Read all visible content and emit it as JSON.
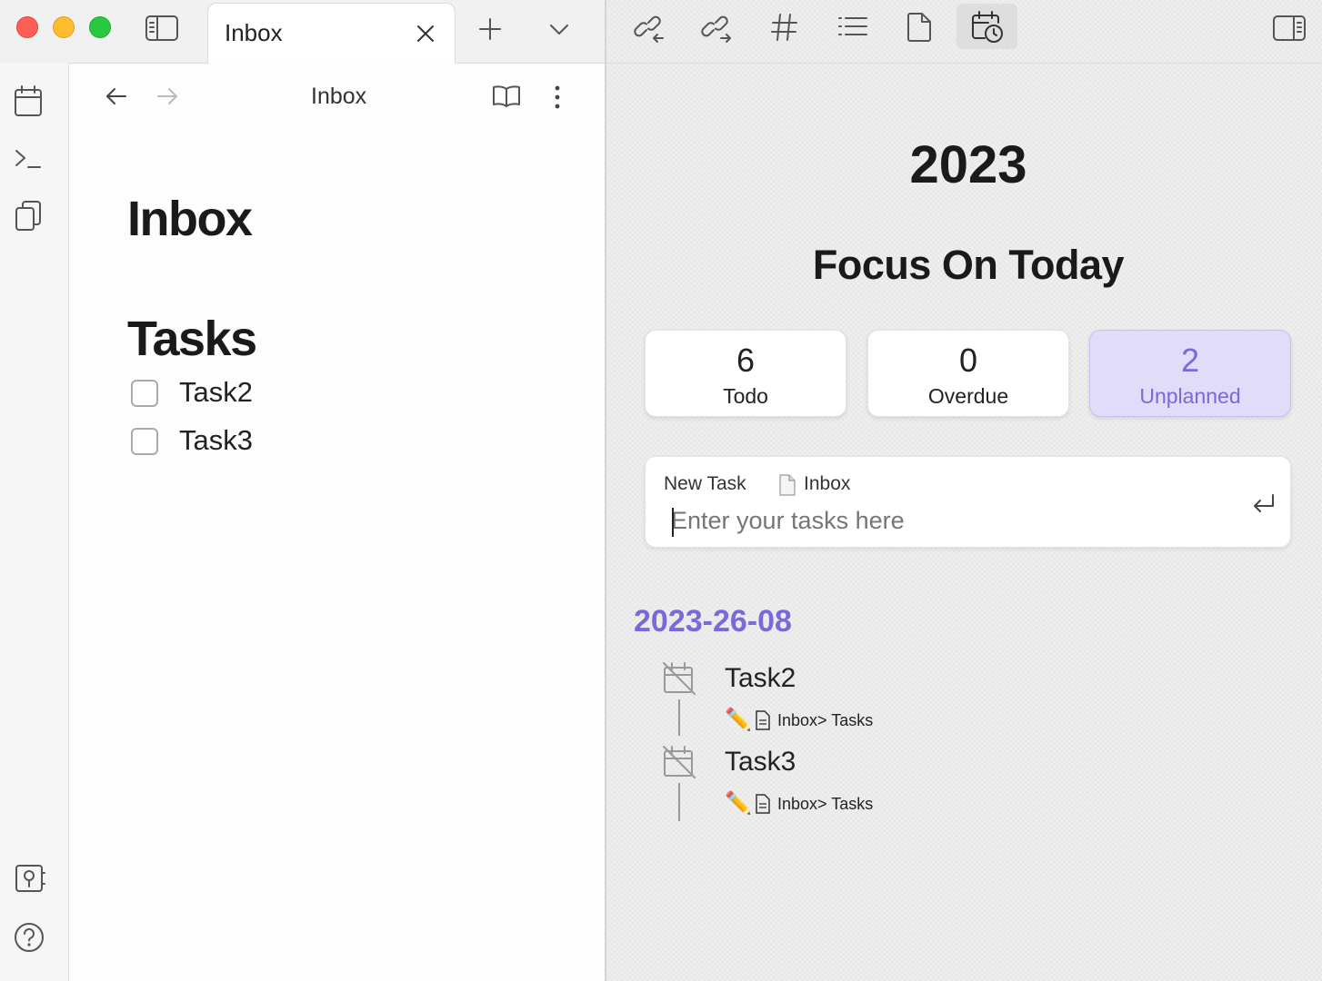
{
  "window": {
    "traffic_colors": {
      "close": "#ff5f57",
      "minimize": "#febc2e",
      "zoom": "#28c840"
    }
  },
  "tabs": [
    {
      "label": "Inbox",
      "active": true
    }
  ],
  "nav": {
    "title": "Inbox"
  },
  "note": {
    "title": "Inbox",
    "section_heading": "Tasks",
    "tasks": [
      {
        "label": "Task2",
        "checked": false
      },
      {
        "label": "Task3",
        "checked": false
      }
    ]
  },
  "right_toolbar": {
    "icons": [
      "backlinks-icon",
      "outgoing-links-icon",
      "tags-icon",
      "outline-icon",
      "file-icon",
      "calendar-clock-icon"
    ],
    "active": "calendar-clock-icon"
  },
  "planner": {
    "year": "2023",
    "heading": "Focus On Today",
    "stats": [
      {
        "value": "6",
        "label": "Todo",
        "active": false
      },
      {
        "value": "0",
        "label": "Overdue",
        "active": false
      },
      {
        "value": "2",
        "label": "Unplanned",
        "active": true
      }
    ],
    "new_task": {
      "label": "New Task",
      "file": "Inbox",
      "placeholder": "Enter your tasks here"
    },
    "date_heading": "2023-26-08",
    "accent": "#7c68d8",
    "items": [
      {
        "title": "Task2",
        "emoji": "✏️",
        "path": "Inbox> Tasks"
      },
      {
        "title": "Task3",
        "emoji": "✏️",
        "path": "Inbox> Tasks"
      }
    ]
  }
}
